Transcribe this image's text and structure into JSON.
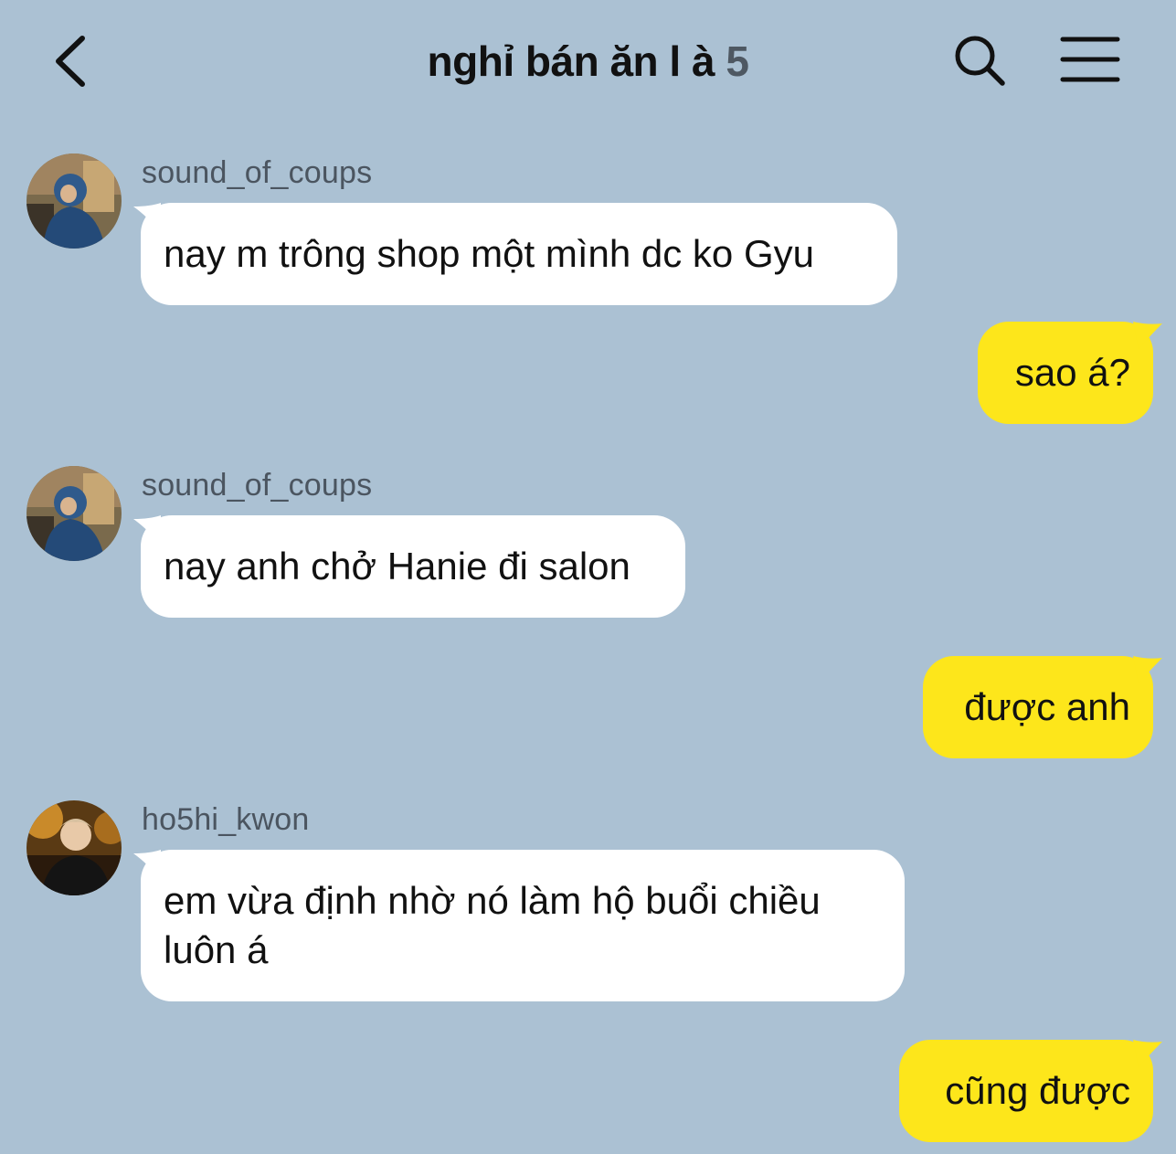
{
  "header": {
    "title": "nghỉ bán ăn l à",
    "member_count": "5"
  },
  "icons": {
    "back": "chevron-left-icon",
    "search": "search-icon",
    "menu": "hamburger-menu-icon"
  },
  "colors": {
    "background": "#abc1d3",
    "incoming_bubble": "#ffffff",
    "outgoing_bubble": "#fde61b"
  },
  "messages": [
    {
      "direction": "in",
      "sender": "sound_of_coups",
      "text": "nay m trông shop một mình dc ko Gyu"
    },
    {
      "direction": "out",
      "text": "sao á?"
    },
    {
      "direction": "in",
      "sender": "sound_of_coups",
      "text": "nay anh chở Hanie đi salon"
    },
    {
      "direction": "out",
      "text": "được anh"
    },
    {
      "direction": "in",
      "sender": "ho5hi_kwon",
      "text": "em vừa định nhờ nó làm hộ buổi chiều luôn á"
    },
    {
      "direction": "out",
      "text": "cũng được"
    }
  ]
}
